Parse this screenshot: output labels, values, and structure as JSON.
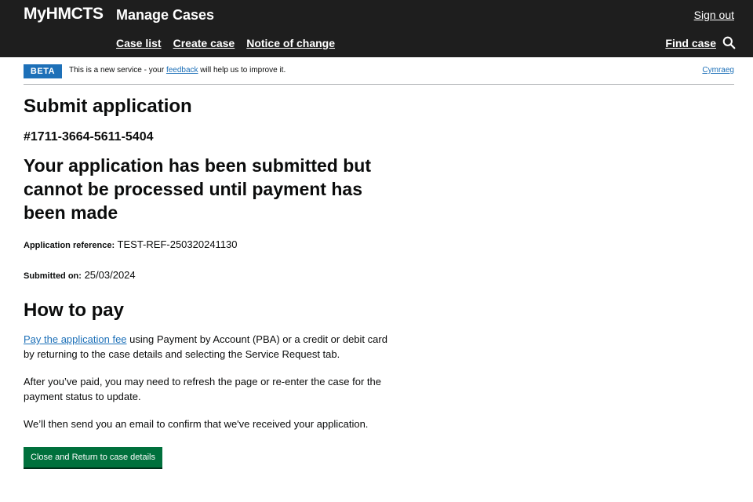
{
  "header": {
    "brand": "MyHMCTS",
    "service_name": "Manage Cases",
    "sign_out": "Sign out",
    "nav": {
      "case_list": "Case list",
      "create_case": "Create case",
      "notice_of_change": "Notice of change"
    },
    "find_case": "Find case"
  },
  "phase_banner": {
    "tag": "BETA",
    "text_before": "This is a new service - your ",
    "link": "feedback",
    "text_after": " will help us to improve it.",
    "language_link": "Cymraeg"
  },
  "main": {
    "title": "Submit application",
    "case_number": "#1711-3664-5611-5404",
    "confirmation": "Your application has been submitted but cannot be processed until payment has been made",
    "application_reference": {
      "label": "Application reference",
      "value": "TEST-REF-250320241130"
    },
    "submitted_on": {
      "label": "Submitted on",
      "value": "25/03/2024"
    },
    "how_to_pay_heading": "How to pay",
    "pay_link": "Pay the application fee",
    "pay_text": " using Payment by Account (PBA) or a credit or debit card by returning to the case details and selecting the Service Request tab.",
    "refresh_text": "After you’ve paid, you may need to refresh the page or re-enter the case for the payment status to update.",
    "email_text": "We’ll then send you an email to confirm that we've received your application.",
    "close_button": "Close and Return to case details"
  },
  "colors": {
    "header_bg": "#1e1e1e",
    "beta_tag": "#1d70b8",
    "link": "#1d70b8",
    "button": "#00703c"
  },
  "icons": [
    "search-icon"
  ]
}
